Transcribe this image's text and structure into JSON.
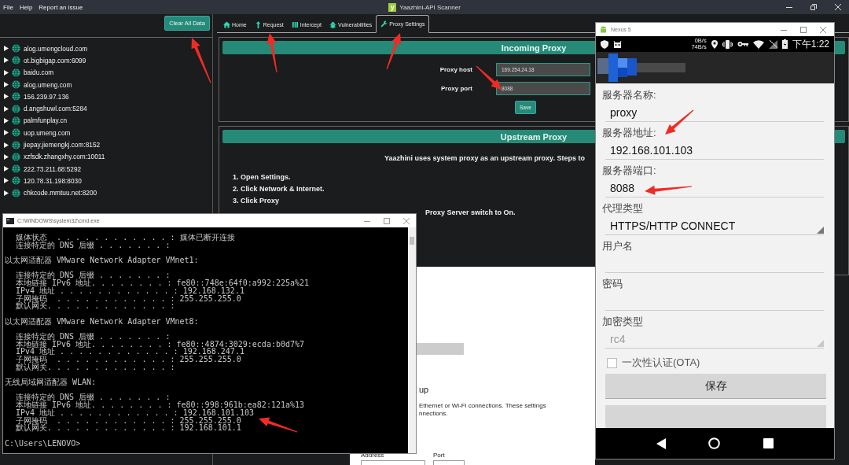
{
  "menu": [
    "File",
    "Help",
    "Report an issue"
  ],
  "window": {
    "title": "Yaazhini-API Scanner",
    "logo": "y"
  },
  "sidebar": {
    "clear_button": "Clear All Data",
    "hosts": [
      {
        "label": "alog.umengcloud.com",
        "expanded": false
      },
      {
        "label": "ot.bigbigap.com:6099",
        "expanded": false
      },
      {
        "label": "baidu.com",
        "expanded": false
      },
      {
        "label": "alog.umeng.com",
        "expanded": false
      },
      {
        "label": "156.239.97.136",
        "expanded": false
      },
      {
        "label": "d.angshuwl.com:5284",
        "expanded": false
      },
      {
        "label": "palmfunplay.cn",
        "expanded": false
      },
      {
        "label": "uop.umeng.com",
        "expanded": false
      },
      {
        "label": "jiepay.jiemengkj.com:8152",
        "expanded": false
      },
      {
        "label": "xzfsdk.zhangxhy.com:10011",
        "expanded": false
      },
      {
        "label": "222.73.211.68:5292",
        "expanded": false
      },
      {
        "label": "120.78.31.198:8030",
        "expanded": false
      },
      {
        "label": "chkcode.mmtuu.net:8200",
        "expanded": false
      }
    ]
  },
  "tabs": [
    {
      "label": "Home",
      "selected": false
    },
    {
      "label": "Request",
      "selected": false
    },
    {
      "label": "Intercept",
      "selected": false
    },
    {
      "label": "Vulnerabilities",
      "selected": false
    },
    {
      "label": "Proxy Settings",
      "selected": true
    }
  ],
  "incoming_proxy": {
    "title": "Incoming Proxy",
    "fields": [
      {
        "label": "Proxy host",
        "value": "169.254.24.18"
      },
      {
        "label": "Proxy port",
        "value": "8088"
      }
    ],
    "save_button": "Save"
  },
  "upstream_proxy": {
    "title": "Upstream Proxy",
    "intro": "Yaazhini uses system proxy as an upstream proxy. Steps to",
    "steps": [
      "1. Open Settings.",
      "2. Click Network & Internet.",
      "3. Click Proxy"
    ],
    "step_fragment": "Proxy Server switch to On."
  },
  "settings_window": {
    "heading": "up",
    "lines": [
      "Ethernet or Wi-Fi connections. These settings",
      "nnections."
    ],
    "address_label": "Address",
    "port_label": "Port"
  },
  "cmd": {
    "title": "C:\\WINDOWS\\system32\\cmd.exe",
    "sections": [
      {
        "lines": [
          "媒体状态  . . . . . . . . . . . . : 媒体已断开连接",
          "连接特定的 DNS 后缀 . . . . . . . :"
        ]
      },
      {
        "heading": "以太网适配器 VMware Network Adapter VMnet1:",
        "lines": [
          "连接特定的 DNS 后缀 . . . . . . . :",
          "本地链接 IPv6 地址. . . . . . . . : fe80::748e:64f0:a992:225a%21",
          "IPv4 地址 . . . . . . . . . . . . : 192.168.132.1",
          "子网掩码  . . . . . . . . . . . . : 255.255.255.0",
          "默认网关. . . . . . . . . . . . . :"
        ]
      },
      {
        "heading": "以太网适配器 VMware Network Adapter VMnet8:",
        "lines": [
          "连接特定的 DNS 后缀 . . . . . . . :",
          "本地链接 IPv6 地址. . . . . . . . : fe80::4874:3029:ecda:b0d7%7",
          "IPv4 地址 . . . . . . . . . . . . : 192.168.247.1",
          "子网掩码  . . . . . . . . . . . . : 255.255.255.0",
          "默认网关. . . . . . . . . . . . . :"
        ]
      },
      {
        "heading": "无线局域网适配器 WLAN:",
        "lines": [
          "连接特定的 DNS 后缀 . . . . . . . :",
          "本地链接 IPv6 地址. . . . . . . . : fe80::998:961b:ea82:121a%13",
          "IPv4 地址 . . . . . . . . . . . . : 192.168.101.103",
          "子网掩码  . . . . . . . . . . . . : 255.255.255.0",
          "默认网关. . . . . . . . . . . . . : 192.168.101.1"
        ]
      }
    ],
    "prompt": "C:\\Users\\LENOVO>"
  },
  "phone": {
    "title": "Nexus 5",
    "status": {
      "up_speed": "0B/s",
      "down_speed": "74B/s",
      "time": "下午1:22"
    },
    "fields": [
      {
        "kind": "text",
        "label": "服务器名称:",
        "value": "proxy"
      },
      {
        "kind": "text",
        "label": "服务器地址:",
        "value": "192.168.101.103"
      },
      {
        "kind": "text",
        "label": "服务器端口:",
        "value": "8088"
      },
      {
        "kind": "select",
        "label": "代理类型",
        "value": "HTTPS/HTTP CONNECT",
        "disabled": false
      },
      {
        "kind": "text",
        "label": "用户名"
      },
      {
        "kind": "text",
        "label": "密码"
      },
      {
        "kind": "select",
        "label": "加密类型",
        "value": "rc4",
        "disabled": true
      }
    ],
    "checkbox": {
      "label": "一次性认证(OTA)",
      "checked": false
    },
    "save_button": "保存"
  }
}
